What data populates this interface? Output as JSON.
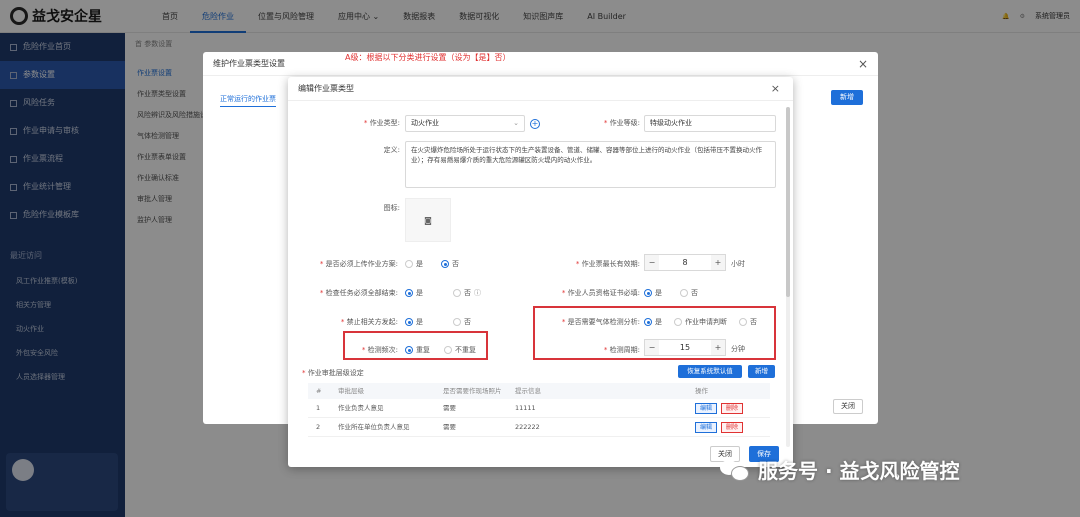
{
  "app": {
    "logo_text": "益戈安企星"
  },
  "topnav": {
    "items": [
      "首页",
      "危险作业",
      "位置与风险管理",
      "应用中心 ⌄",
      "数据报表",
      "数据可视化",
      "知识图声库",
      "AI Builder"
    ],
    "active_index": 1
  },
  "top_right": {
    "user_name": "系统管理员"
  },
  "sidebar": {
    "items": [
      "危险作业首页",
      "参数设置",
      "风险任务",
      "作业申请与审核",
      "作业票流程",
      "作业统计管理",
      "危险作业模板库"
    ],
    "active_index": 1,
    "section_title": "最近访问",
    "recent": [
      "风工作业推票(模板)",
      "相关方管理",
      "动火作业",
      "外包安全风险",
      "人员选择器管理"
    ]
  },
  "breadcrumb": "首 参数设置",
  "subnav": [
    "作业票设置",
    "作业票类型设置",
    "风险辨识及风险措施设置",
    "气体检测管理",
    "作业票表单设置",
    "作业确认标准",
    "审批人管理",
    "监护人管理"
  ],
  "outer_modal": {
    "title": "维护作业票类型设置",
    "tab": "正常运行的作业票",
    "new_label": "新增",
    "close_label": "关闭"
  },
  "red_note": "A级：根据以下分类进行设置（设为【是】否）",
  "modal": {
    "title": "编辑作业票类型",
    "close_icon": "×",
    "job_type_label": "作业类型:",
    "job_type_value": "动火作业",
    "job_level_label": "作业等级:",
    "job_level_value": "特级动火作业",
    "definition_label": "定义:",
    "definition_value": "在火灾爆炸危险场所处于运行状态下的生产装置设备、管道、储罐、容器等部位上进行的动火作业（包括带压不置换动火作业）；存有易燃易爆介质的重大危险源罐区防火堤内的动火作业。",
    "icon_label": "图标:",
    "upload_plan_label": "是否必须上传作业方案:",
    "upload_plan_yes": "是",
    "upload_plan_no": "否",
    "max_valid_label": "作业票最长有效期:",
    "max_valid_value": "8",
    "max_valid_unit": "小时",
    "check_all_label": "检查任务必须全部结束:",
    "check_all_yes": "是",
    "check_all_no": "否",
    "cert_label": "作业人员资格证书必填:",
    "cert_yes": "是",
    "cert_no": "否",
    "forbid_label": "禁止相关方发起:",
    "forbid_yes": "是",
    "forbid_no": "否",
    "gas_label": "是否需要气体检测分析:",
    "gas_yes": "是",
    "gas_judge": "作业申请判断",
    "gas_no": "否",
    "freq_label": "检测频次:",
    "freq_repeat": "重复",
    "freq_norepeat": "不重复",
    "period_label": "检测周期:",
    "period_value": "15",
    "period_unit": "分钟",
    "approval_label": "作业审批层级设定",
    "restore_label": "恢复系统默认值",
    "add_label": "新增",
    "table_headers": [
      "#",
      "审批层级",
      "是否需要作现场照片",
      "提示信息",
      "操作"
    ],
    "table_rows": [
      {
        "no": "1",
        "level": "作业负责人意见",
        "photo": "需要",
        "tip": "11111",
        "edit": "编辑",
        "del": "删除"
      },
      {
        "no": "2",
        "level": "作业所在单位负责人意见",
        "photo": "需要",
        "tip": "222222",
        "edit": "编辑",
        "del": "删除"
      }
    ],
    "cancel_label": "关闭",
    "save_label": "保存"
  },
  "watermark": "服务号 · 益戈风险管控"
}
